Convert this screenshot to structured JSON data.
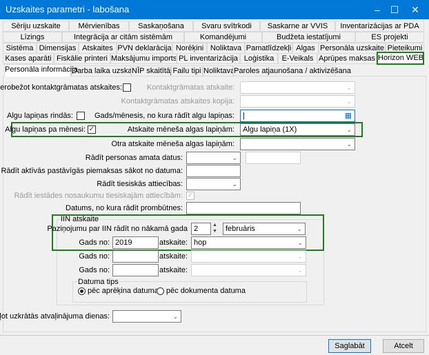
{
  "window": {
    "title": "Uzskaites parametri - labošana",
    "minimize": "–",
    "maximize": "☐",
    "close": "✕"
  },
  "tab_rows": [
    [
      "Sēriju uzskaite",
      "Mērvienības",
      "Saskaņošana",
      "Svaru svītrkodi",
      "Saskarne ar VVIS",
      "Inventarizācijas ar PDA"
    ],
    [
      "Līzings",
      "Integrācija ar citām sistēmām",
      "Komandējumi",
      "Budžeta iestatījumi",
      "ES projekti"
    ],
    [
      "Sistēma",
      "Dimensijas",
      "Atskaites",
      "PVN deklarācija",
      "Norēķini",
      "Noliktava",
      "Pamatlīdzekļi",
      "Algas",
      "Personāla uzskaite",
      "Pieteikumi"
    ],
    [
      "Kases aparāti",
      "Fiskālie printeri",
      "Maksājumu imports",
      "PL inventarizācija",
      "Loģistika",
      "E-Veikals",
      "Aprūpes maksas",
      "Horizon WEB"
    ]
  ],
  "selected_tab": "Horizon WEB",
  "inner_tabs": [
    "Personāla informācija",
    "Darba laika uzskaite",
    "NĪP skaitītāji",
    "Failu tipi",
    "Noliktava",
    "Paroles atjaunošana / aktivizēšana"
  ],
  "form": {
    "ierobezot_label": "Ierobežot kontaktgrāmatas atskaites:",
    "kontakt_atskaite_label": "Kontaktgrāmatas atskaite:",
    "kontakt_kopija_label": "Kontaktgrāmatas atskaites kopija:",
    "rindas_label": "Algu lapiņas rindās:",
    "gads_menesis_label": "Gads/mēnesis, no kura rādīt algu lapiņas:",
    "pa_menesi_label": "Algu lapiņas pa mēnesi:",
    "pa_menesi_checked": true,
    "atskaite_label": "Atskaite mēneša algas lapiņām:",
    "atskaite_value": "Algu lapiņa (1X)",
    "otra_label": "Otra atskaite mēneša algas lapiņām:",
    "amata_label": "Rādīt personas amata datus:",
    "piemaksas_label": "Rādīt aktīvās pastāvīgās piemaksas sākot no datuma:",
    "tiesiskas_label": "Rādīt tiesiskās attiecības:",
    "iestades_label": "Rādīt iestādes nosaukumu tiesiskajām attiecībām:",
    "iestades_checked": true,
    "prombutnes_label": "Datums, no kura rādīt prombūtnes:",
    "iin": {
      "title": "IIN atskaite",
      "pazinojums_label": "Paziņojumu par IIN rādīt no nākamā gada",
      "day": "2",
      "month": "februāris",
      "gads_label": "Gads no:",
      "atskaite_label": "atskaite:",
      "rows": [
        {
          "year": "2019",
          "report": "hop"
        },
        {
          "year": "",
          "report": ""
        },
        {
          "year": "",
          "report": ""
        }
      ],
      "datuma_tips": {
        "title": "Datuma tips",
        "options": [
          "pēc aprēķina datuma",
          "pēc dokumenta datuma"
        ],
        "selected": "pēc aprēķina datuma"
      }
    },
    "apalot_label": "Apaļot uzkrātās atvaļinājuma dienas:"
  },
  "buttons": {
    "save": "Saglabāt",
    "cancel": "Atcelt"
  },
  "colors": {
    "titlebar": "#0078d7",
    "highlight": "#1a7f1a"
  }
}
